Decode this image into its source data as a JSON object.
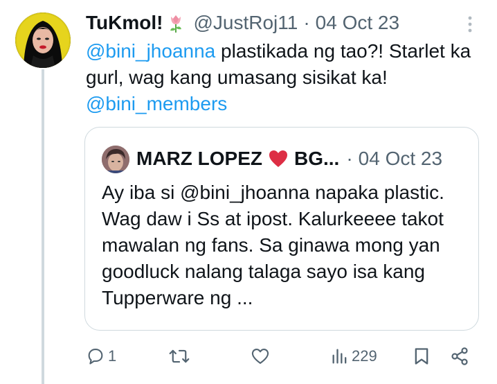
{
  "tweet": {
    "display_name": "TuKmol!",
    "name_emoji": "tulip-emoji",
    "handle": "@JustRoj11",
    "separator": "·",
    "date": "04 Oct 23",
    "text_mention_1": "@bini_jhoanna",
    "text_body": " plastikada ng tao?! Starlet ka gurl, wag kang umasang sisikat ka!",
    "text_mention_2": "@bini_members"
  },
  "quoted_tweet": {
    "display_name_part1": "MARZ LOPEZ",
    "name_emoji": "red-heart-emoji",
    "display_name_part2": "BG...",
    "separator": "·",
    "date": "04 Oct 23",
    "text": "Ay iba si @bini_jhoanna napaka plastic. Wag daw i Ss at ipost. Kalurkeeee takot mawalan ng fans. Sa ginawa mong yan goodluck nalang talaga sayo isa kang Tupperware ng ..."
  },
  "actions": {
    "reply_count": "1",
    "retweet_count": "",
    "like_count": "",
    "views_count": "229"
  },
  "colors": {
    "mention": "#1d9bf0",
    "secondary_text": "#536471",
    "border": "#cfd9de",
    "primary_text": "#0f1419"
  }
}
